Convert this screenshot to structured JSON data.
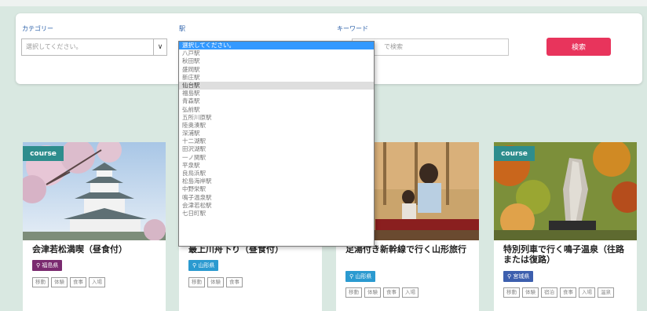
{
  "search": {
    "category_label": "カテゴリー",
    "category_value": "選択してください。",
    "station_label": "駅",
    "keyword_label": "キーワード",
    "keyword_placeholder": "で検索",
    "search_button": "検索"
  },
  "station_dropdown": {
    "options": [
      "選択してください。",
      "八戸駅",
      "秋田駅",
      "盛岡駅",
      "新庄駅",
      "仙台駅",
      "福島駅",
      "青森駅",
      "弘前駅",
      "五所川原駅",
      "陸奥湊駅",
      "深浦駅",
      "十二湖駅",
      "田沢湖駅",
      "一ノ関駅",
      "平泉駅",
      "良鳥浜駅",
      "松島海岸駅",
      "中野栄駅",
      "鳴子温泉駅",
      "会津若松駅",
      "七日町駅"
    ],
    "highlighted_index": 0,
    "hover_index": 5
  },
  "cards": [
    {
      "tag": "course",
      "title": "会津若松満喫（昼食付）",
      "prefecture": "福島県",
      "pref_color": "#7a2a6f",
      "chips": [
        "移動",
        "体験",
        "食事",
        "入場"
      ]
    },
    {
      "tag": "course",
      "title": "最上川舟下り（昼食付）",
      "prefecture": "山形県",
      "pref_color": "#2b9ad0",
      "chips": [
        "移動",
        "体験",
        "食事"
      ]
    },
    {
      "tag": "course",
      "title": "足湯付き新幹線で行く山形旅行",
      "prefecture": "山形県",
      "pref_color": "#2b9ad0",
      "chips": [
        "移動",
        "体験",
        "食事",
        "入場"
      ]
    },
    {
      "tag": "course",
      "title": "特別列車で行く鳴子温泉（往路または復路）",
      "prefecture": "宮城県",
      "pref_color": "#3d5fae",
      "chips": [
        "移動",
        "体験",
        "宿泊",
        "食事",
        "入場",
        "温泉"
      ]
    }
  ],
  "colors": {
    "accent_button": "#e8345c",
    "course_tag": "#2e8d8d",
    "background": "#d9e8e1"
  }
}
